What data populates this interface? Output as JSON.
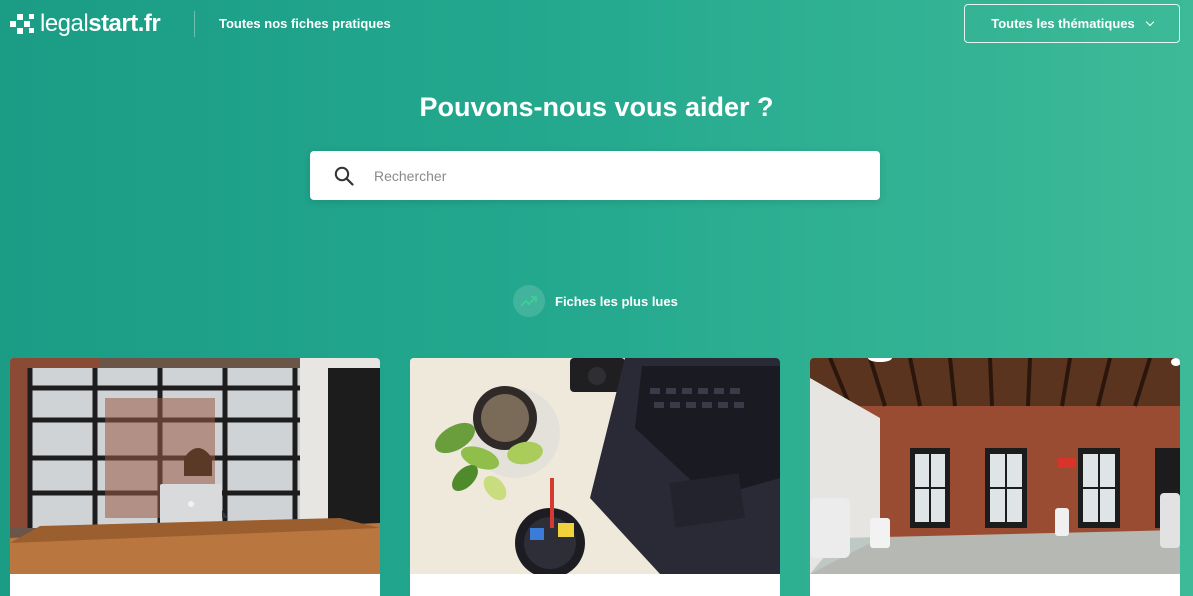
{
  "header": {
    "logo_light": "legal",
    "logo_bold": "start",
    "logo_suffix": ".fr",
    "nav_link": "Toutes nos fiches pratiques",
    "themes_button": "Toutes les thématiques"
  },
  "hero": {
    "title": "Pouvons-nous vous aider ?"
  },
  "search": {
    "placeholder": "Rechercher",
    "value": "",
    "icon": "search-icon"
  },
  "popular": {
    "icon": "trending-up-icon",
    "label": "Fiches les plus lues"
  },
  "cards": [
    {
      "image": "woman-working-on-laptop-at-table-photo"
    },
    {
      "image": "desk-with-laptop-and-plant-photo"
    },
    {
      "image": "empty-brick-office-room-photo"
    }
  ],
  "colors": {
    "background_start": "#1b9c85",
    "background_end": "#3dba98",
    "trend_icon": "#3ecf95"
  }
}
